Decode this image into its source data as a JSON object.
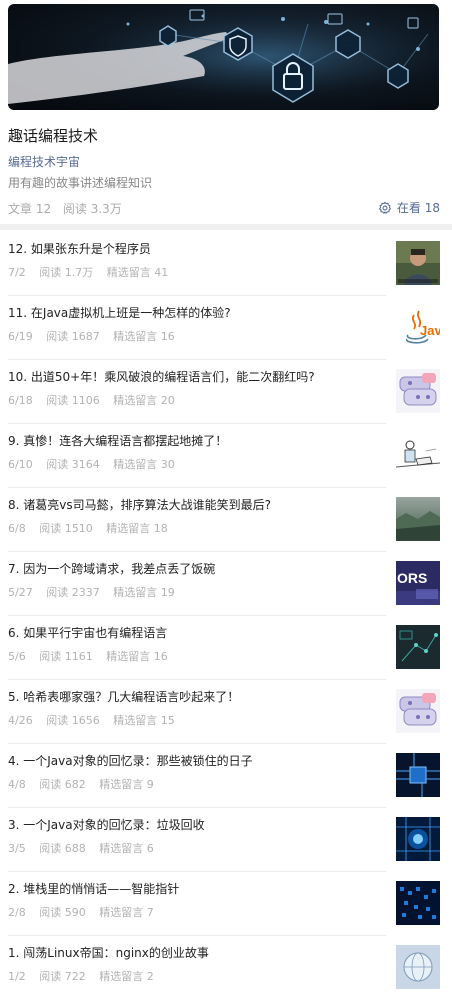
{
  "album": {
    "title": "趣话编程技术",
    "author": "编程技术宇宙",
    "description": "用有趣的故事讲述编程知识",
    "articles": "文章 12",
    "reads": "阅读 3.3万",
    "watching": "在看 18"
  },
  "items": [
    {
      "title": "12. 如果张东升是个程序员",
      "date": "7/2",
      "reads": "阅读 1.7万",
      "comments": "精选留言 41",
      "thumb": "person-photo"
    },
    {
      "title": "11. 在Java虚拟机上班是一种怎样的体验?",
      "date": "6/19",
      "reads": "阅读 1687",
      "comments": "精选留言 16",
      "thumb": "java-logo",
      "thumb_text": "Java"
    },
    {
      "title": "10. 出道50+年！乘风破浪的编程语言们，能二次翻红吗?",
      "date": "6/18",
      "reads": "阅读 1106",
      "comments": "精选留言 20",
      "thumb": "languages-sticker"
    },
    {
      "title": "9. 真惨！连各大编程语言都摆起地摊了！",
      "date": "6/10",
      "reads": "阅读 3164",
      "comments": "精选留言 30",
      "thumb": "street-sketch"
    },
    {
      "title": "8. 诸葛亮vs司马懿，排序算法大战谁能笑到最后?",
      "date": "6/8",
      "reads": "阅读 1510",
      "comments": "精选留言 18",
      "thumb": "landscape"
    },
    {
      "title": "7. 因为一个跨域请求，我差点丢了饭碗",
      "date": "5/27",
      "reads": "阅读 2337",
      "comments": "精选留言 19",
      "thumb": "cors-laptop",
      "thumb_text": "ORS"
    },
    {
      "title": "6. 如果平行宇宙也有编程语言",
      "date": "5/6",
      "reads": "阅读 1161",
      "comments": "精选留言 16",
      "thumb": "dark-tech"
    },
    {
      "title": "5. 哈希表哪家强？几大编程语言吵起来了！",
      "date": "4/26",
      "reads": "阅读 1656",
      "comments": "精选留言 15",
      "thumb": "languages-sticker"
    },
    {
      "title": "4. 一个Java对象的回忆录：那些被锁住的日子",
      "date": "4/8",
      "reads": "阅读 682",
      "comments": "精选留言 9",
      "thumb": "blue-chip"
    },
    {
      "title": "3. 一个Java对象的回忆录：垃圾回收",
      "date": "3/5",
      "reads": "阅读 688",
      "comments": "精选留言 6",
      "thumb": "blue-circuit"
    },
    {
      "title": "2. 堆栈里的悄悄话——智能指针",
      "date": "2/8",
      "reads": "阅读 590",
      "comments": "精选留言 7",
      "thumb": "blue-grid"
    },
    {
      "title": "1. 闯荡Linux帝国：nginx的创业故事",
      "date": "1/2",
      "reads": "阅读 722",
      "comments": "精选留言 2",
      "thumb": "globe-light"
    }
  ]
}
